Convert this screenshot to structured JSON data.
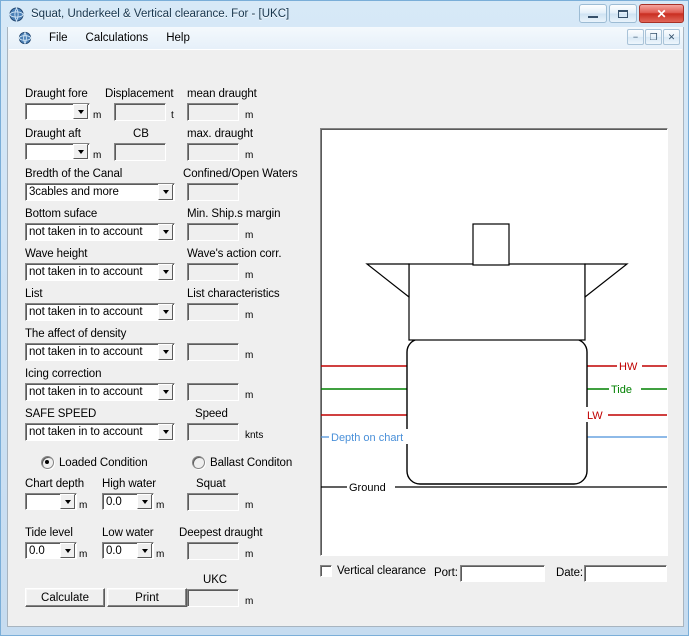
{
  "window": {
    "title": "Squat, Underkeel & Vertical clearance. For  - [UKC]",
    "minimize_label": "Minimize",
    "maximize_label": "Maximize",
    "close_label": "✕",
    "mdi_minimize": "−",
    "mdi_restore": "❐",
    "mdi_close": "✕"
  },
  "menu": {
    "items": [
      "File",
      "Calculations",
      "Help"
    ]
  },
  "left_column": [
    {
      "label": "Draught fore",
      "type": "combo",
      "value": "",
      "unit": "m"
    },
    {
      "label": "Draught aft",
      "type": "combo",
      "value": "",
      "unit": "m"
    },
    {
      "label": "Bredth of the Canal",
      "type": "combo",
      "value": "3cables and more",
      "unit": ""
    },
    {
      "label": "Bottom sufaсe",
      "type": "combo",
      "value": "not taken in to account",
      "unit": ""
    },
    {
      "label": "Wave height",
      "type": "combo",
      "value": "not taken in to account",
      "unit": ""
    },
    {
      "label": "List",
      "type": "combo",
      "value": "not taken in to account",
      "unit": ""
    },
    {
      "label": "The affect of density",
      "type": "combo",
      "value": "not taken in to account",
      "unit": ""
    },
    {
      "label": "Icing correction",
      "type": "combo",
      "value": "not taken in to account",
      "unit": ""
    },
    {
      "label": "SAFE SPEED",
      "type": "combo",
      "value": "not taken in to account",
      "unit": ""
    }
  ],
  "mid_column": [
    {
      "label": "Displacement",
      "value": "",
      "unit": "t"
    },
    {
      "label": "CB",
      "value": "",
      "unit": ""
    }
  ],
  "right_column": [
    {
      "label": "mean draught",
      "value": "",
      "unit": "m"
    },
    {
      "label": "max. draught",
      "value": "",
      "unit": "m"
    },
    {
      "label": "Confined/Open Waters",
      "value": "",
      "unit": ""
    },
    {
      "label": "Min. Ship.s margin",
      "value": "",
      "unit": "m"
    },
    {
      "label": "Wave's action corr.",
      "value": "",
      "unit": "m"
    },
    {
      "label": "List characteristics",
      "value": "",
      "unit": "m"
    },
    {
      "label": "",
      "value": "",
      "unit": "m"
    },
    {
      "label": "",
      "value": "",
      "unit": "m"
    },
    {
      "label": "Speed",
      "value": "",
      "unit": "knts"
    }
  ],
  "condition": {
    "loaded_label": "Loaded Condition",
    "loaded_selected": true,
    "ballast_label": "Ballast Conditon",
    "ballast_selected": false
  },
  "depth_fields": {
    "chart_depth_label": "Chart depth",
    "chart_depth_value": "",
    "chart_depth_unit": "m",
    "high_water_label": "High water",
    "high_water_value": "0.0",
    "high_water_unit": "m",
    "squat_label": "Squat",
    "squat_value": "",
    "squat_unit": "m",
    "tide_level_label": "Tide level",
    "tide_level_value": "0.0",
    "tide_level_unit": "m",
    "low_water_label": "Low water",
    "low_water_value": "0.0",
    "low_water_unit": "m",
    "deepest_draught_label": "Deepest draught",
    "deepest_draught_value": "",
    "deepest_draught_unit": "m",
    "ukc_label": "UKC",
    "ukc_value": "",
    "ukc_unit": "m"
  },
  "actions": {
    "calculate_label": "Calculate",
    "print_label": "Print"
  },
  "diagram": {
    "labels": {
      "hw": "HW",
      "tide": "Tide",
      "lw": "LW",
      "depth_on_chart": "Depth on chart",
      "ground": "Ground"
    },
    "colors": {
      "hw": "#C00000",
      "tide": "#008000",
      "lw": "#C00000",
      "depth_on_chart": "#4A90D9",
      "ground": "#000000",
      "hull": "#000000"
    },
    "line_y": {
      "hw": 237,
      "tide": 260,
      "lw": 286,
      "depth_on_chart": 308,
      "ground": 358
    }
  },
  "footer": {
    "vertical_clearance_label": "Vertical clearance",
    "vertical_clearance_checked": false,
    "port_label": "Port:",
    "port_value": "",
    "date_label": "Date:",
    "date_value": ""
  }
}
